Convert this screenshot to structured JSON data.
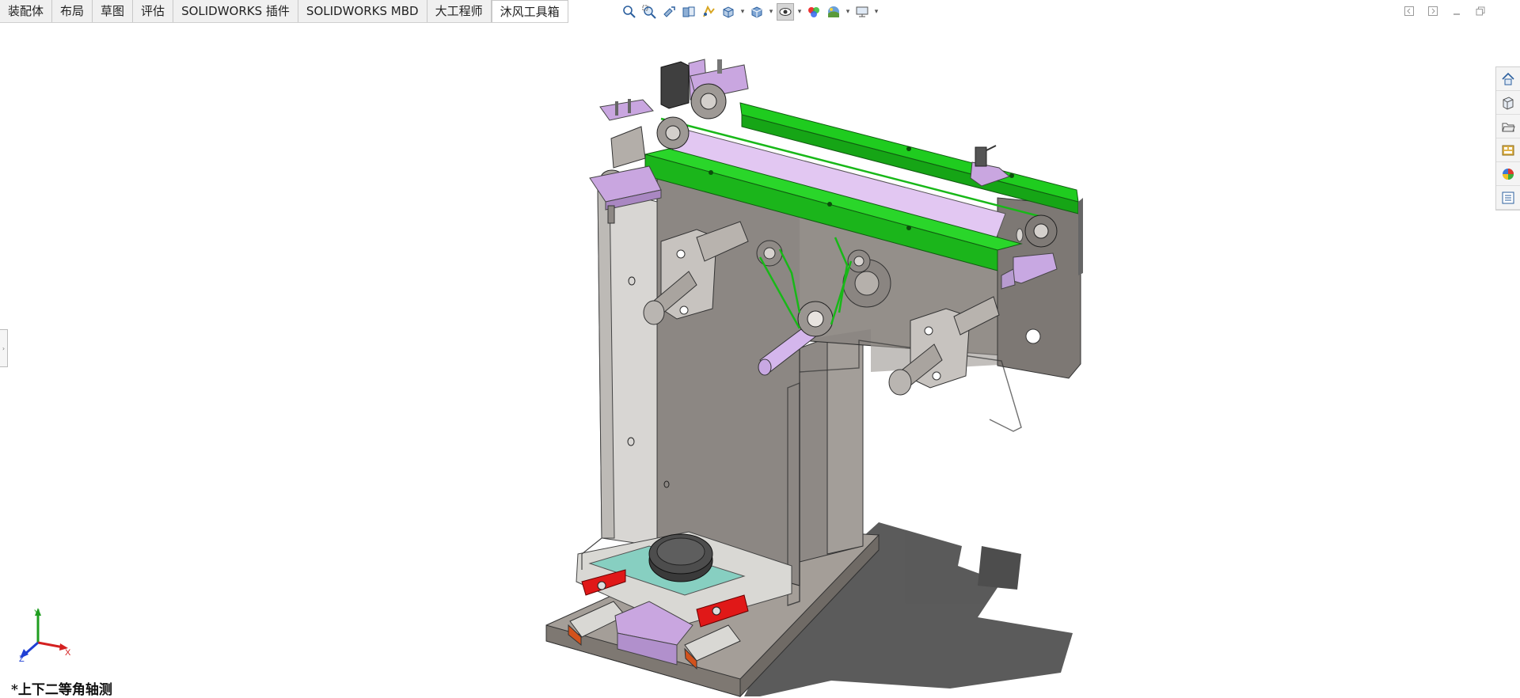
{
  "command_manager": {
    "tabs": [
      {
        "label": "装配体",
        "active": false
      },
      {
        "label": "布局",
        "active": false
      },
      {
        "label": "草图",
        "active": false
      },
      {
        "label": "评估",
        "active": false
      },
      {
        "label": "SOLIDWORKS 插件",
        "active": false
      },
      {
        "label": "SOLIDWORKS MBD",
        "active": false
      },
      {
        "label": "大工程师",
        "active": false
      },
      {
        "label": "沐风工具箱",
        "active": true
      }
    ]
  },
  "view_toolbar": {
    "icons": [
      "zoom-to-fit-icon",
      "zoom-to-area-icon",
      "previous-view-icon",
      "section-view-icon",
      "dynamic-annotation-icon",
      "view-orientation-icon",
      "display-style-icon",
      "hide-show-items-icon",
      "edit-appearance-icon",
      "apply-scene-icon",
      "view-settings-icon"
    ]
  },
  "window_controls": [
    "tile-left-icon",
    "tile-right-icon",
    "minimize-icon",
    "restore-icon"
  ],
  "task_pane": [
    "home-icon",
    "design-library-icon",
    "file-explorer-icon",
    "view-palette-icon",
    "appearances-scenes-icon",
    "custom-properties-icon"
  ],
  "viewport": {
    "view_name": "*上下二等角轴测",
    "triad": {
      "x": "X",
      "y": "Y",
      "z": "Z"
    },
    "colors": {
      "green_rail": "#1fcc1f",
      "purple_part": "#c9a6e0",
      "gray_plate": "#8f8a86",
      "base": "#a9a39e",
      "red_block": "#e01818",
      "shadow": "#4a4a4a"
    }
  }
}
